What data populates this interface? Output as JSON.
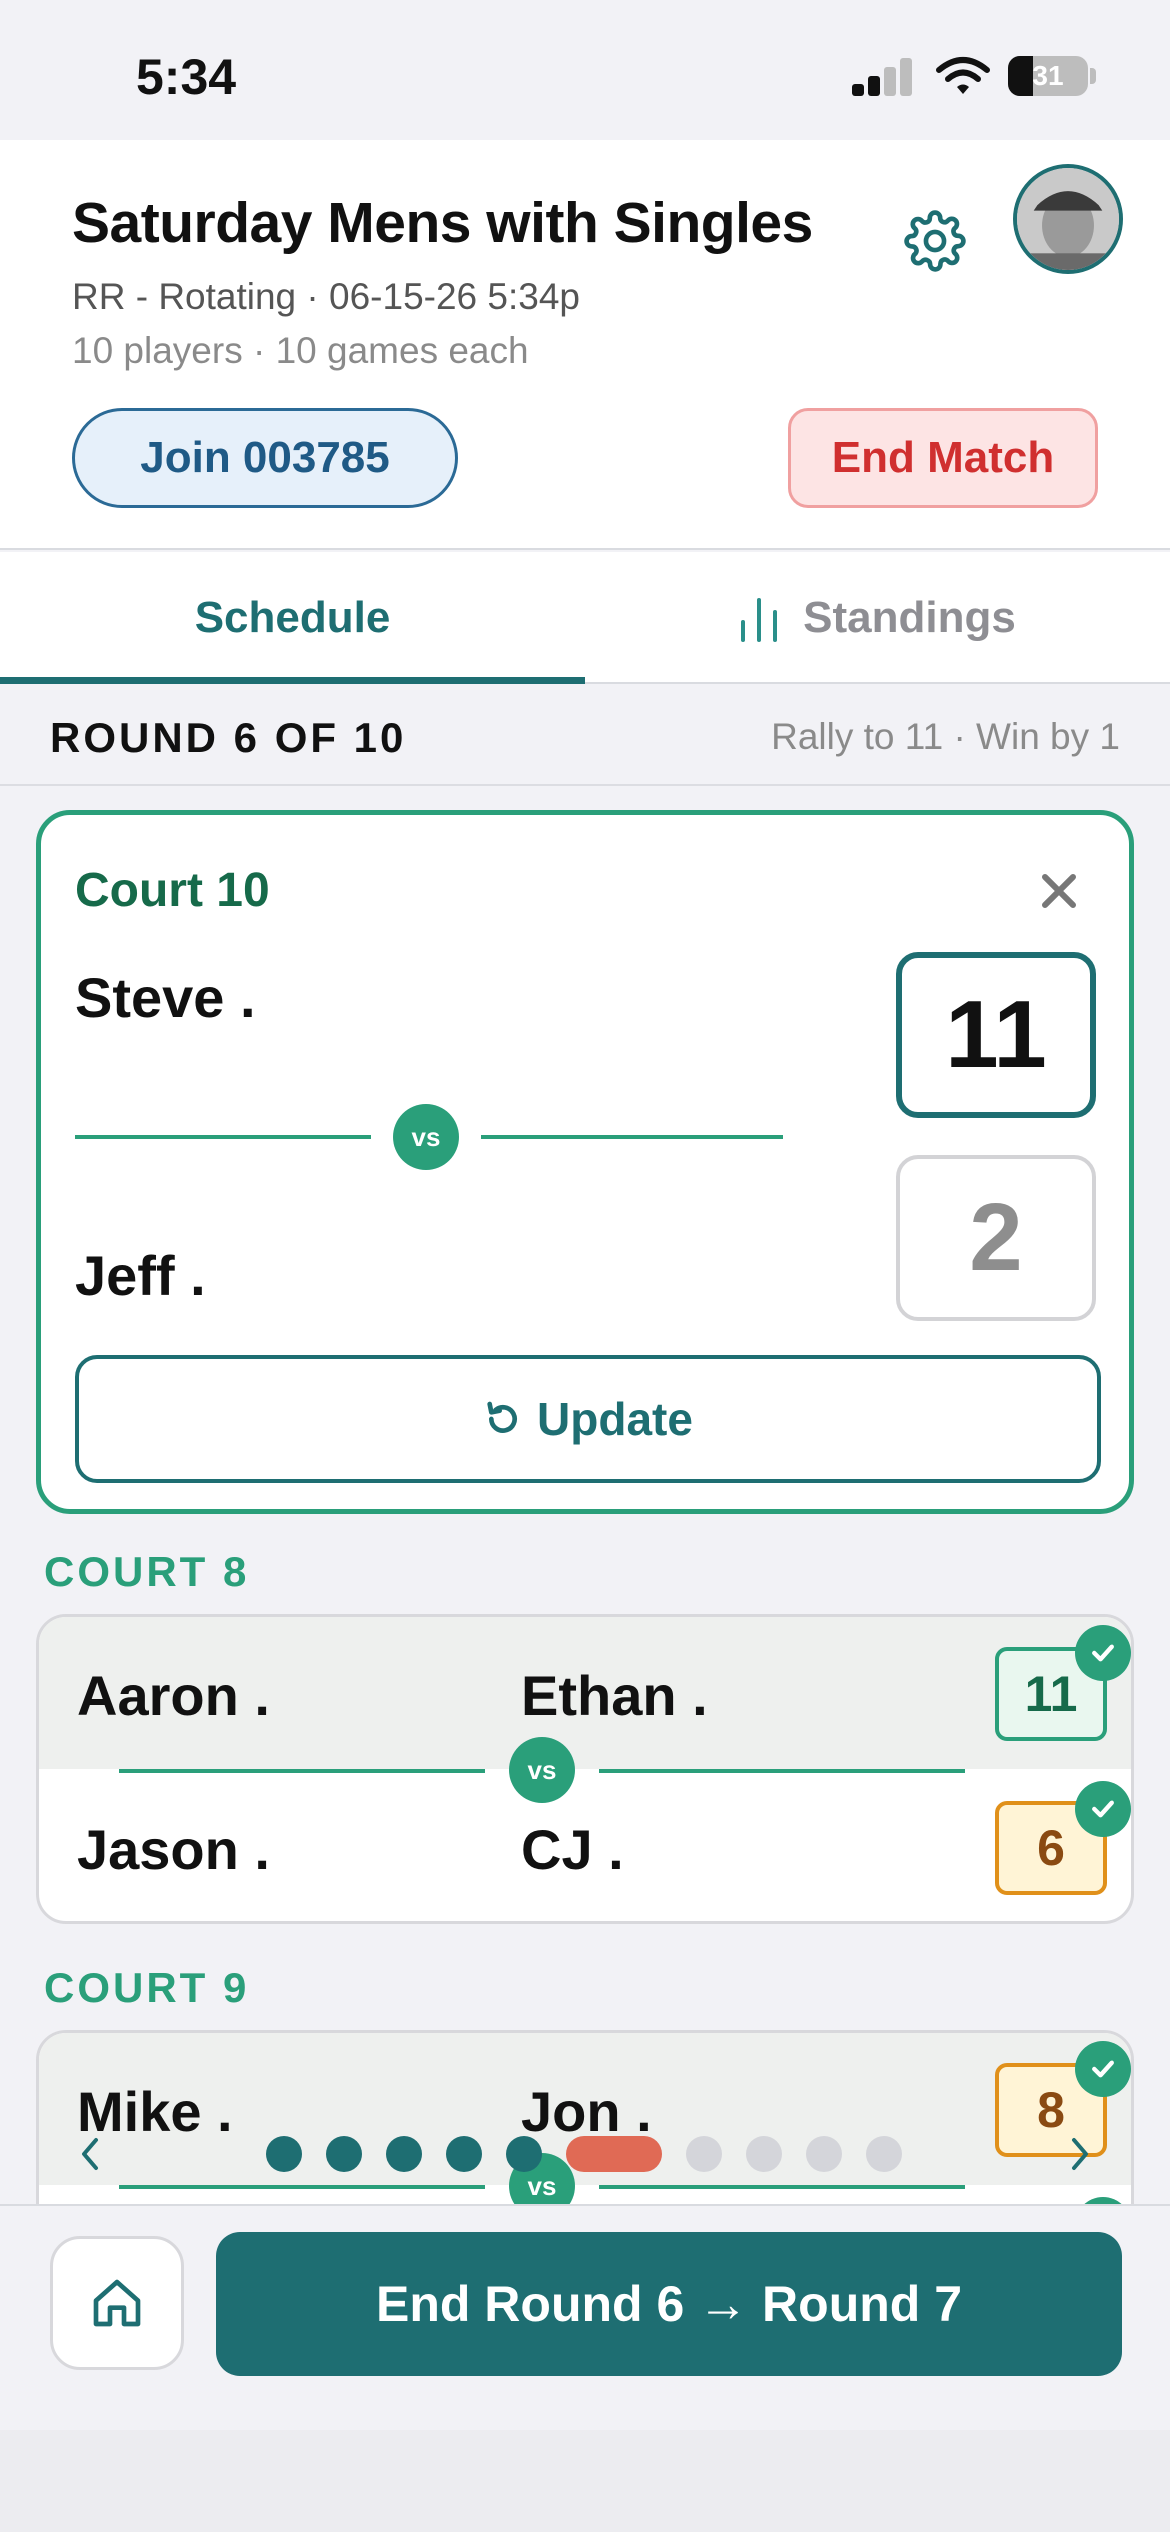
{
  "status_bar": {
    "time": "5:34",
    "battery": "31"
  },
  "header": {
    "title": "Saturday Mens with Singles",
    "subtitle": "RR - Rotating · 06-15-26 5:34p",
    "details": "10 players · 10 games each",
    "join_label": "Join 003785",
    "end_match_label": "End Match"
  },
  "tabs": {
    "schedule": "Schedule",
    "standings": "Standings"
  },
  "round": {
    "title": "ROUND 6 OF 10",
    "rules": "Rally to 11 · Win by 1"
  },
  "active_court": {
    "title": "Court 10",
    "player1": "Steve .",
    "player2": "Jeff .",
    "vs": "vs",
    "score1": "11",
    "score2": "2",
    "update_label": "Update"
  },
  "courts": [
    {
      "label": "COURT 8",
      "team1": [
        "Aaron .",
        "Ethan ."
      ],
      "team2": [
        "Jason .",
        "CJ ."
      ],
      "score1": "11",
      "score2": "6",
      "vs": "vs"
    },
    {
      "label": "COURT 9",
      "team1": [
        "Mike .",
        "Jon ."
      ],
      "score1": "8",
      "vs": "vs"
    }
  ],
  "pager": {
    "total_rounds": 10,
    "current_round": 6
  },
  "bottom": {
    "end_round_label": "End Round 6 → Round 7"
  },
  "colors": {
    "primary_teal": "#1e6e72",
    "accent_green": "#2a9f7a",
    "danger_red": "#d02f2f",
    "current_dot": "#e06a55"
  }
}
